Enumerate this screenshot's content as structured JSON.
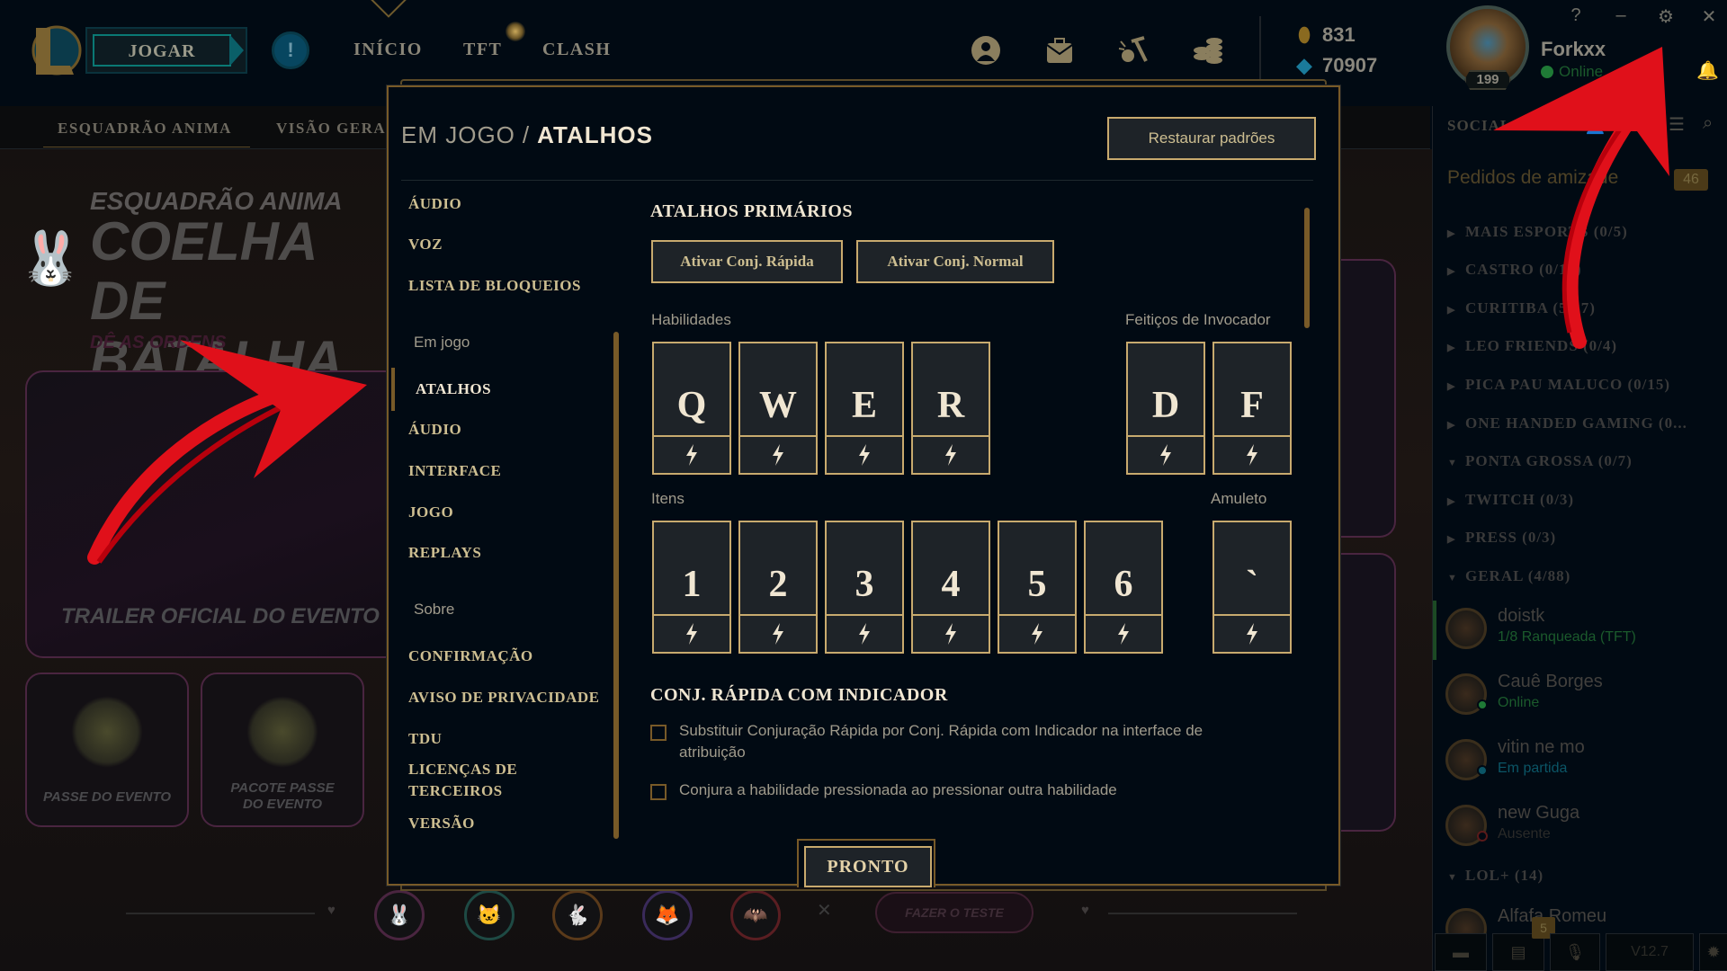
{
  "topbar": {
    "play_label": "JOGAR",
    "nav": [
      "INÍCIO",
      "TFT",
      "CLASH"
    ],
    "icons": [
      "profile-icon",
      "inventory-icon",
      "crafting-icon",
      "store-icon"
    ],
    "currency": {
      "blue_essence": "831",
      "riot_points": "70907"
    },
    "summoner": {
      "name": "Forkxx",
      "status": "Online",
      "level": "199"
    },
    "window_controls": [
      "?",
      "–",
      "⚙",
      "✕"
    ]
  },
  "subnav": {
    "items": [
      "ESQUADRÃO ANIMA",
      "VISÃO GERA"
    ]
  },
  "hero": {
    "subtitle": "ESQUADRÃO ANIMA",
    "title": "COELHA DE BATALHA",
    "tagline": "DÊ AS ORDENS",
    "trailer": "TRAILER OFICIAL DO EVENTO",
    "cards": [
      "PASSE DO EVENTO",
      "PACOTE PASSE DO EVENTO"
    ],
    "quiz_button": "FAZER O TESTE",
    "colors": {
      "accent_pink": "#4a2540"
    }
  },
  "modal": {
    "breadcrumb": {
      "parent": "EM JOGO",
      "separator": "/",
      "current": "ATALHOS"
    },
    "restore_button": "Restaurar padrões",
    "done_button": "PRONTO",
    "nav": [
      {
        "label": "ÁUDIO",
        "type": "item"
      },
      {
        "label": "VOZ",
        "type": "item"
      },
      {
        "label": "LISTA DE BLOQUEIOS",
        "type": "item"
      },
      {
        "label": "Em jogo",
        "type": "header"
      },
      {
        "label": "ATALHOS",
        "type": "item",
        "active": true
      },
      {
        "label": "ÁUDIO",
        "type": "item"
      },
      {
        "label": "INTERFACE",
        "type": "item"
      },
      {
        "label": "JOGO",
        "type": "item"
      },
      {
        "label": "REPLAYS",
        "type": "item"
      },
      {
        "label": "Sobre",
        "type": "header"
      },
      {
        "label": "CONFIRMAÇÃO",
        "type": "item"
      },
      {
        "label": "AVISO DE PRIVACIDADE",
        "type": "item"
      },
      {
        "label": "TDU",
        "type": "item"
      },
      {
        "label": "LICENÇAS DE TERCEIROS",
        "type": "item"
      },
      {
        "label": "VERSÃO",
        "type": "item"
      }
    ],
    "primary": {
      "title": "ATALHOS PRIMÁRIOS",
      "quick_cast_button": "Ativar Conj. Rápida",
      "normal_cast_button": "Ativar Conj. Normal",
      "abilities_label": "Habilidades",
      "abilities": [
        "Q",
        "W",
        "E",
        "R"
      ],
      "summoner_label": "Feitiços de Invocador",
      "summoners": [
        "D",
        "F"
      ],
      "items_label": "Itens",
      "items": [
        "1",
        "2",
        "3",
        "4",
        "5",
        "6"
      ],
      "trinket_label": "Amuleto",
      "trinket": "`"
    },
    "indicator": {
      "title": "CONJ. RÁPIDA COM INDICADOR",
      "options": [
        {
          "label": "Substituir Conjuração Rápida por Conj. Rápida com Indicador na interface de atribuição",
          "checked": false
        },
        {
          "label": "Conjura a habilidade pressionada ao pressionar outra habilidade",
          "checked": false
        }
      ]
    },
    "colors": {
      "gold": "#c8aa6e",
      "gold_dark": "#785a28",
      "bg": "#010a13",
      "key_bg": "#1e2328",
      "text_light": "#f0e6d2"
    }
  },
  "social": {
    "title": "SOCIAL",
    "friend_requests": {
      "label": "Pedidos de amizade",
      "count": "46"
    },
    "groups": [
      {
        "label": "MAIS ESPORTS (0/5)",
        "expanded": false
      },
      {
        "label": "CASTRO (0/14)",
        "expanded": false
      },
      {
        "label": "CURITIBA (5/37)",
        "expanded": false
      },
      {
        "label": "LEO FRIENDS (0/4)",
        "expanded": false
      },
      {
        "label": "PICA PAU MALUCO (0/15)",
        "expanded": false
      },
      {
        "label": "ONE HANDED GAMING (0...",
        "expanded": false
      },
      {
        "label": "PONTA GROSSA (0/7)",
        "expanded": true
      },
      {
        "label": "TWITCH (0/3)",
        "expanded": false
      },
      {
        "label": "PRESS (0/3)",
        "expanded": false
      },
      {
        "label": "GERAL (4/88)",
        "expanded": true
      }
    ],
    "friends": [
      {
        "name": "doistk",
        "status": "1/8 Ranqueada (TFT)",
        "status_color": "#1b5a2c"
      },
      {
        "name": "Cauê Borges",
        "status": "Online",
        "status_color": "#1b5a2c"
      },
      {
        "name": "vitin ne mo",
        "status": "Em partida",
        "status_color": "#0b5566"
      },
      {
        "name": "new Guga",
        "status": "Ausente",
        "status_color": "#2a2a28"
      }
    ],
    "group_lol_plus": {
      "label": "LOL+ (14)",
      "expanded": true
    },
    "partial_friend": "Alfafa Romeu",
    "footer": {
      "missions_badge": "5",
      "version": "V12.7"
    }
  }
}
